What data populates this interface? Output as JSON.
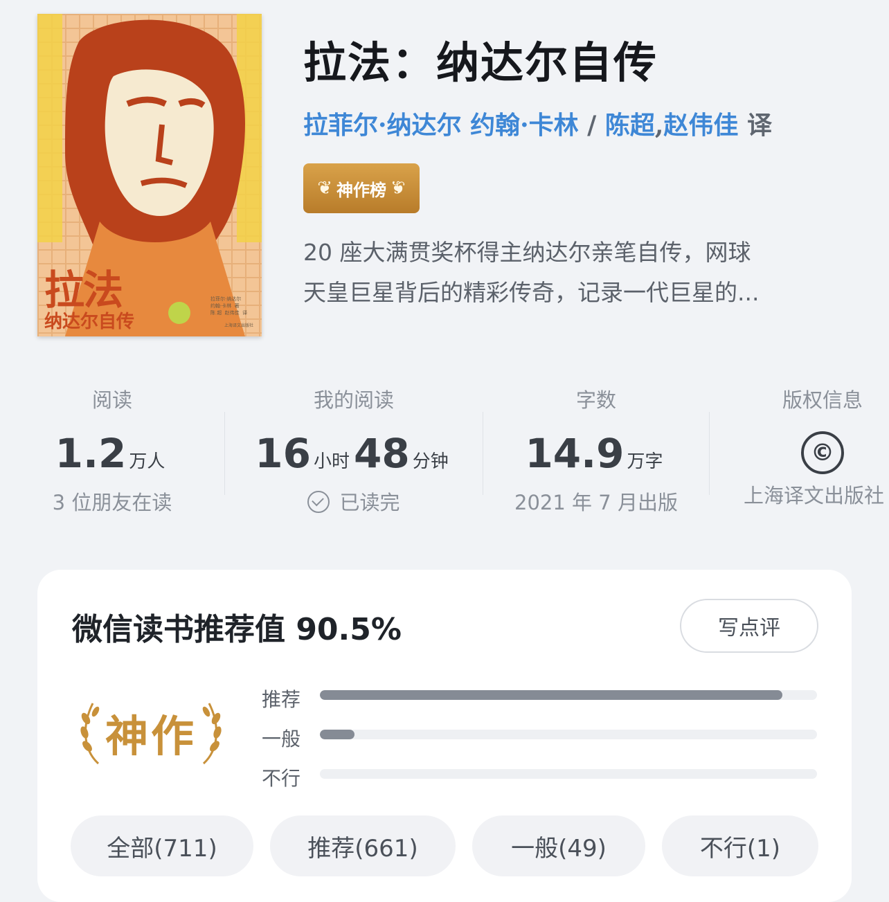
{
  "book": {
    "title": "拉法：纳达尔自传",
    "author1": "拉菲尔·纳达尔 约翰·卡林",
    "slash": " / ",
    "translator1": "陈超",
    "comma": ",",
    "translator2": "赵伟佳",
    "translate_suffix": " 译",
    "badge": "神作榜",
    "description_line1": "20 座大满贯奖杯得主纳达尔亲笔自传，网球",
    "description_line2": "天皇巨星背后的精彩传奇，记录一代巨星的..."
  },
  "cover": {
    "title": "拉法",
    "subtitle": "纳达尔自传",
    "credit": "拉菲尔·纳达尔\n约翰·卡林  著\n陈 超  赵伟佳  译",
    "publisher": "上海译文出版社"
  },
  "stats": {
    "reading": {
      "label": "阅读",
      "number": "1.2",
      "unit": "万人",
      "sub": "3 位朋友在读"
    },
    "my_reading": {
      "label": "我的阅读",
      "hours": "16",
      "hours_unit": "小时",
      "minutes": "48",
      "minutes_unit": "分钟",
      "sub": "已读完"
    },
    "words": {
      "label": "字数",
      "number": "14.9",
      "unit": "万字",
      "sub": "2021 年 7 月出版"
    },
    "copyright": {
      "label": "版权信息",
      "symbol": "©",
      "sub": "上海译文出版社"
    }
  },
  "rating": {
    "title": "微信读书推荐值 90.5%",
    "write_button": "写点评",
    "rank_label": "神作",
    "bars": [
      {
        "label": "推荐",
        "fraction": 0.93
      },
      {
        "label": "一般",
        "fraction": 0.07
      },
      {
        "label": "不行",
        "fraction": 0.0
      }
    ],
    "filters": [
      "全部(711)",
      "推荐(661)",
      "一般(49)",
      "不行(1)"
    ]
  },
  "colors": {
    "link": "#3e87d6",
    "badge_gold": "#c8913a",
    "bar_fill": "#858b95"
  }
}
